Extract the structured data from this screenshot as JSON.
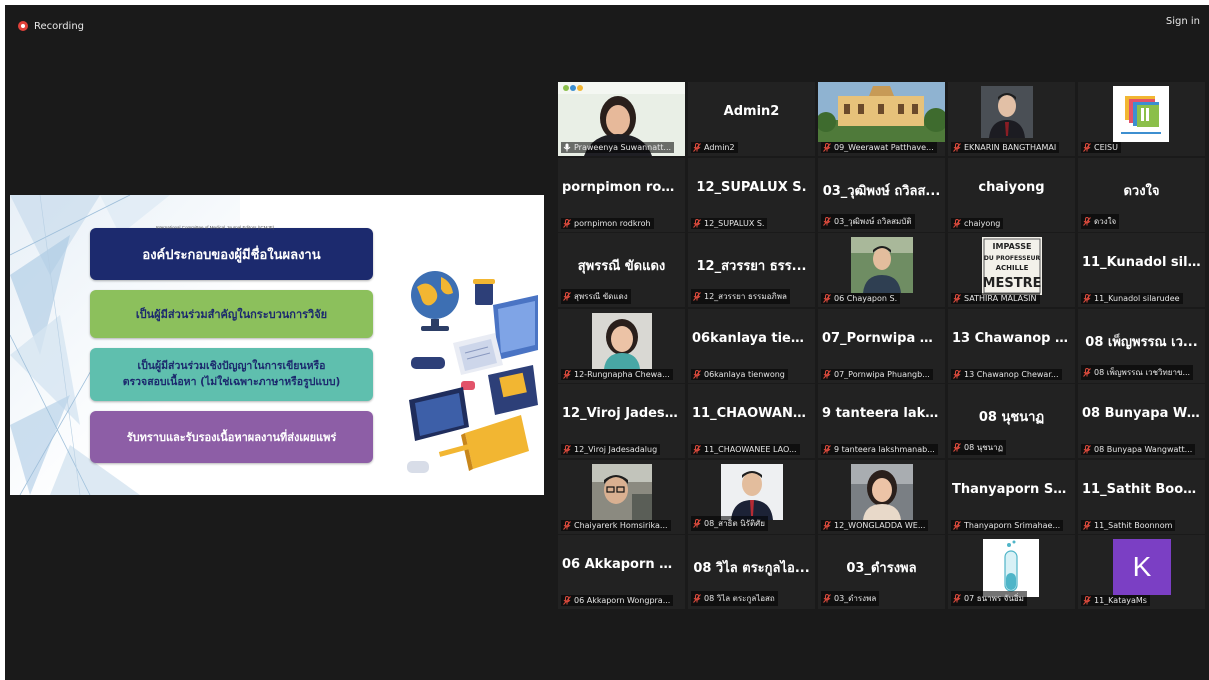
{
  "topbar": {
    "recording_label": "Recording",
    "signin_label": "Sign in"
  },
  "colors": {
    "background": "#1a1a1a",
    "recording_dot": "#e0413a",
    "active_speaker_border": "#c9d65b",
    "muted_icon": "#d94a3c"
  },
  "slide": {
    "committee_text": "International Committee of Medical Journal Editors (ICMJE)",
    "title": "องค์ประกอบของผู้มีชื่อในผลงาน",
    "item1": "เป็นผู้มีส่วนร่วมสำคัญในกระบวนการวิจัย",
    "item2_line1": "เป็นผู้มีส่วนร่วมเชิงปัญญาในการเขียนหรือ",
    "item2_line2": "ตรวจสอบเนื้อหา (ไม่ใช่เฉพาะภาษาหรือรูปแบบ)",
    "item3": "รับทราบและรับรองเนื้อหาผลงานที่ส่งเผยแพร่"
  },
  "participants": [
    {
      "big": "",
      "label": "Praweenya Suwannatt...",
      "type": "video-woman",
      "muted": false,
      "active": true
    },
    {
      "big": "Admin2",
      "label": "Admin2",
      "type": "name",
      "muted": true
    },
    {
      "big": "",
      "label": "09_Weerawat Patthave...",
      "type": "photo-building",
      "muted": true
    },
    {
      "big": "",
      "label": "EKNARIN BANGTHAMAI",
      "type": "photo-man-dark",
      "muted": true
    },
    {
      "big": "",
      "label": "CEISU",
      "type": "photo-logo",
      "muted": true
    },
    {
      "big": "pornpimon rod...",
      "label": "pornpimon rodkroh",
      "type": "name",
      "muted": true
    },
    {
      "big": "12_SUPALUX S.",
      "label": "12_SUPALUX S.",
      "type": "name",
      "muted": true
    },
    {
      "big": "03_วุฒิพงษ์ ถวิลส...",
      "label": "03_วุฒิพงษ์ ถวิลสมบัติ",
      "type": "name",
      "muted": true
    },
    {
      "big": "chaiyong",
      "label": "chaiyong",
      "type": "name",
      "muted": true
    },
    {
      "big": "ดวงใจ",
      "label": "ดวงใจ",
      "type": "name",
      "muted": true
    },
    {
      "big": "สุพรรณี ขัดแดง",
      "label": "สุพรรณี ขัดแดง",
      "type": "name",
      "muted": true
    },
    {
      "big": "12_สวรรยา ธรร...",
      "label": "12_สวรรยา ธรรมอภิพล",
      "type": "name",
      "muted": true
    },
    {
      "big": "",
      "label": "06 Chayapon S.",
      "type": "photo-man-green",
      "muted": true
    },
    {
      "big": "",
      "label": "SATHIRA MALASIN",
      "type": "photo-sign",
      "muted": true,
      "sign_lines": [
        "IMPASSE",
        "DU PROFESSEUR",
        "ACHILLE",
        "MESTRE"
      ]
    },
    {
      "big": "11_Kunadol sila...",
      "label": "11_Kunadol silarudee",
      "type": "name",
      "muted": true
    },
    {
      "big": "",
      "label": "12-Rungnapha Chewa...",
      "type": "photo-woman-teal",
      "muted": true
    },
    {
      "big": "06kanlaya tien...",
      "label": "06kanlaya tienwong",
      "type": "name",
      "muted": true
    },
    {
      "big": "07_Pornwipa Ph...",
      "label": "07_Pornwipa Phuangb...",
      "type": "name",
      "muted": true
    },
    {
      "big": "13 Chawanop C...",
      "label": "13 Chawanop Chewar...",
      "type": "name",
      "muted": true
    },
    {
      "big": "08 เพ็ญพรรณ เว...",
      "label": "08 เพ็ญพรรณ เวชวิทยาข...",
      "type": "name",
      "muted": true
    },
    {
      "big": "12_Viroj Jadesa...",
      "label": "12_Viroj Jadesadalug",
      "type": "name",
      "muted": true
    },
    {
      "big": "11_CHAOWANE...",
      "label": "11_CHAOWANEE LAO...",
      "type": "name",
      "muted": true
    },
    {
      "big": "9 tanteera laksh...",
      "label": "9 tanteera lakshmanab...",
      "type": "name",
      "muted": true
    },
    {
      "big": "08 นุชนาฏ",
      "label": "08 นุชนาฏ",
      "type": "name",
      "muted": true
    },
    {
      "big": "08 Bunyapa Wa...",
      "label": "08 Bunyapa Wangwatt...",
      "type": "name",
      "muted": true
    },
    {
      "big": "",
      "label": "Chaiyarerk Homsirika...",
      "type": "photo-man-glasses",
      "muted": true
    },
    {
      "big": "",
      "label": "08_สาธิต นิรัติศัย",
      "type": "photo-man-suit",
      "muted": true
    },
    {
      "big": "",
      "label": "12_WONGLADDA WE...",
      "type": "photo-woman-hair",
      "muted": true
    },
    {
      "big": "Thanyaporn Sri...",
      "label": "Thanyaporn Srimahae...",
      "type": "name",
      "muted": true
    },
    {
      "big": "11_Sathit Boon...",
      "label": "11_Sathit Boonnom",
      "type": "name",
      "muted": true
    },
    {
      "big": "06 Akkaporn W...",
      "label": "06 Akkaporn Wongpra...",
      "type": "name",
      "muted": true
    },
    {
      "big": "08 วิไล ตระกูลไอ...",
      "label": "08 วิไล ตระกูลไอสถ",
      "type": "name",
      "muted": true
    },
    {
      "big": "03_ดำรงพล",
      "label": "03_ดำรงพล",
      "type": "name",
      "muted": true
    },
    {
      "big": "",
      "label": "07 ธนาพร จันอิ่ม",
      "type": "photo-flask",
      "muted": true
    },
    {
      "big": "",
      "label": "11_KatayaMs",
      "type": "photo-avatar-k",
      "muted": true,
      "avatar_letter": "K"
    }
  ]
}
